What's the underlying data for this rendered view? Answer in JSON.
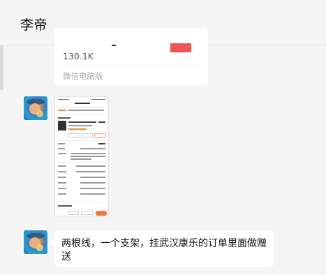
{
  "header": {
    "title": "李帝"
  },
  "messages": [
    {
      "type": "link_card",
      "count_text": "130.1K",
      "source": "微信电脑版"
    },
    {
      "type": "image",
      "description": "phone-screenshot-order-detail"
    },
    {
      "type": "text",
      "text": "两根线，一个支架，挂武汉康乐的订单里面做赠送"
    }
  ],
  "colors": {
    "background": "#f5f5f5",
    "bubble": "#ffffff",
    "accent_red": "#f05555",
    "accent_orange": "#f07b3a"
  }
}
